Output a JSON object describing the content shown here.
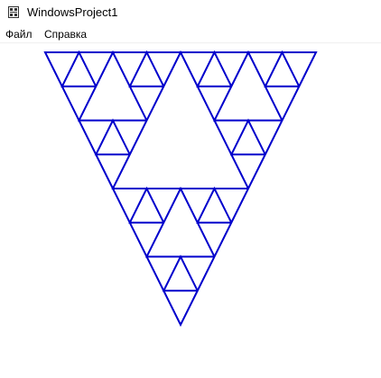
{
  "window": {
    "title": "WindowsProject1",
    "icon": "app-window-icon"
  },
  "menu": {
    "items": [
      {
        "label": "Файл"
      },
      {
        "label": "Справка"
      }
    ]
  },
  "canvas": {
    "figure": "sierpinski-triangle-curve",
    "stroke_color": "#0000cc",
    "background_color": "#ffffff"
  }
}
